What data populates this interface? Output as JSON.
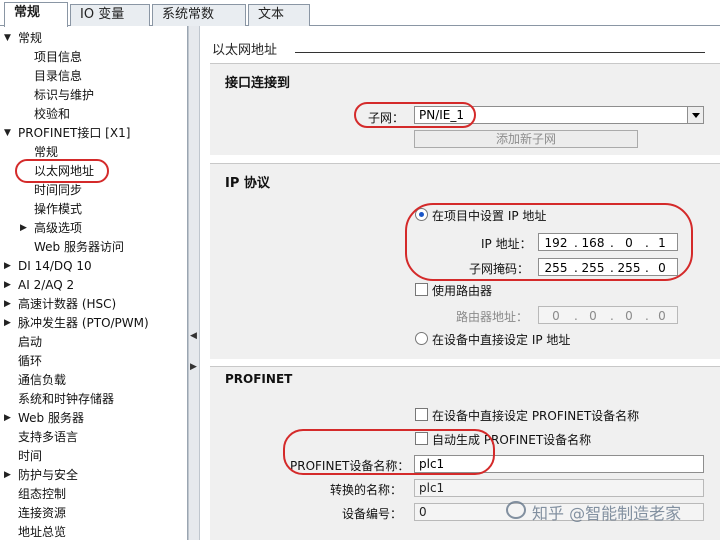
{
  "tabs": [
    {
      "label": "常规",
      "active": true
    },
    {
      "label": "IO 变量",
      "active": false
    },
    {
      "label": "系统常数",
      "active": false
    },
    {
      "label": "文本",
      "active": false
    }
  ],
  "tree": {
    "items": [
      {
        "label": "常规",
        "arrow": "▼"
      },
      {
        "label": "项目信息",
        "arrow": ""
      },
      {
        "label": "目录信息",
        "arrow": ""
      },
      {
        "label": "标识与维护",
        "arrow": ""
      },
      {
        "label": "校验和",
        "arrow": ""
      },
      {
        "label": "PROFINET接口 [X1]",
        "arrow": "▼"
      },
      {
        "label": "常规",
        "arrow": ""
      },
      {
        "label": "以太网地址",
        "arrow": ""
      },
      {
        "label": "时间同步",
        "arrow": ""
      },
      {
        "label": "操作模式",
        "arrow": ""
      },
      {
        "label": "高级选项",
        "arrow": "▶"
      },
      {
        "label": "Web 服务器访问",
        "arrow": ""
      },
      {
        "label": "DI 14/DQ 10",
        "arrow": "▶"
      },
      {
        "label": "AI 2/AQ 2",
        "arrow": "▶"
      },
      {
        "label": "高速计数器 (HSC)",
        "arrow": "▶"
      },
      {
        "label": "脉冲发生器 (PTO/PWM)",
        "arrow": "▶"
      },
      {
        "label": "启动",
        "arrow": ""
      },
      {
        "label": "循环",
        "arrow": ""
      },
      {
        "label": "通信负载",
        "arrow": ""
      },
      {
        "label": "系统和时钟存储器",
        "arrow": ""
      },
      {
        "label": "Web 服务器",
        "arrow": "▶"
      },
      {
        "label": "支持多语言",
        "arrow": ""
      },
      {
        "label": "时间",
        "arrow": ""
      },
      {
        "label": "防护与安全",
        "arrow": "▶"
      },
      {
        "label": "组态控制",
        "arrow": ""
      },
      {
        "label": "连接资源",
        "arrow": ""
      },
      {
        "label": "地址总览",
        "arrow": ""
      }
    ]
  },
  "splitter": {
    "arrow_left": "◀",
    "arrow_right": "▶"
  },
  "main": {
    "title": "以太网地址",
    "interface": {
      "heading": "接口连接到",
      "subnet_label": "子网：",
      "subnet_value": "PN/IE_1",
      "add_subnet_button": "添加新子网"
    },
    "ip": {
      "heading": "IP 协议",
      "radio_project": "在项目中设置 IP 地址",
      "ip_label": "IP 地址：",
      "ip_address": [
        "192",
        "168",
        "0",
        "1"
      ],
      "mask_label": "子网掩码：",
      "subnet_mask": [
        "255",
        "255",
        "255",
        "0"
      ],
      "router_checkbox": "使用路由器",
      "router_label": "路由器地址：",
      "router_address": [
        "0",
        "0",
        "0",
        "0"
      ],
      "radio_device": "在设备中直接设定 IP 地址"
    },
    "profinet": {
      "heading": "PROFINET",
      "cb_device_name_direct": "在设备中直接设定 PROFINET设备名称",
      "cb_auto_name": "自动生成 PROFINET设备名称",
      "device_name_label": "PROFINET设备名称：",
      "device_name": "plc1",
      "converted_label": "转换的名称：",
      "converted_name": "plc1",
      "device_number_label": "设备编号：",
      "device_number": "0"
    }
  },
  "watermark": "知乎 @智能制造老家",
  "colors": {
    "annotation": "#d42a2a",
    "radio_selected": "#1a56c8"
  }
}
